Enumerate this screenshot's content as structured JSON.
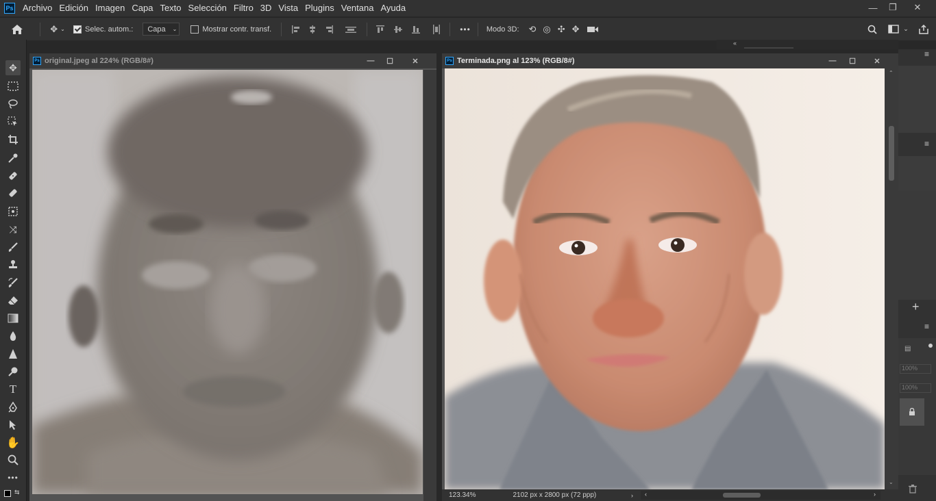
{
  "app": {
    "logo": "Ps"
  },
  "menu": [
    "Archivo",
    "Edición",
    "Imagen",
    "Capa",
    "Texto",
    "Selección",
    "Filtro",
    "3D",
    "Vista",
    "Plugins",
    "Ventana",
    "Ayuda"
  ],
  "window_controls": {
    "minimize": "—",
    "restore": "❐",
    "close": "✕"
  },
  "options_bar": {
    "auto_select_label": "Selec. autom.:",
    "auto_select_checked": true,
    "layer_select_value": "Capa",
    "show_transform_label": "Mostrar contr. transf.",
    "show_transform_checked": false,
    "mode3d_label": "Modo 3D:",
    "more_label": "•••"
  },
  "documents": [
    {
      "title": "original.jpeg al 224% (RGB/8#)"
    },
    {
      "title": "Terminada.png al 123% (RGB/8#)",
      "zoom": "123.34%",
      "dims": "2102 px x 2800 px (72 ppp)"
    }
  ],
  "right_panel": {
    "opacity_a": "100%",
    "opacity_b": "100%"
  },
  "icons": [
    "home-icon",
    "move-icon",
    "marquee-icon",
    "lasso-icon",
    "object-select-icon",
    "crop-icon",
    "eyedropper-icon",
    "healing-icon",
    "brush-icon",
    "stamp-icon",
    "history-brush-icon",
    "eraser-icon",
    "gradient-icon",
    "blur-icon",
    "sharpen-icon",
    "dodge-icon",
    "type-icon",
    "pen-icon",
    "path-select-icon",
    "hand-icon",
    "zoom-icon",
    "more-icon",
    "search-icon",
    "workspace-icon",
    "share-icon",
    "lock-icon",
    "trash-icon",
    "add-icon"
  ],
  "colors": {
    "bg_dark": "#282828",
    "panel": "#323232",
    "doc_frame": "#535353",
    "accent": "#31a8ff"
  }
}
